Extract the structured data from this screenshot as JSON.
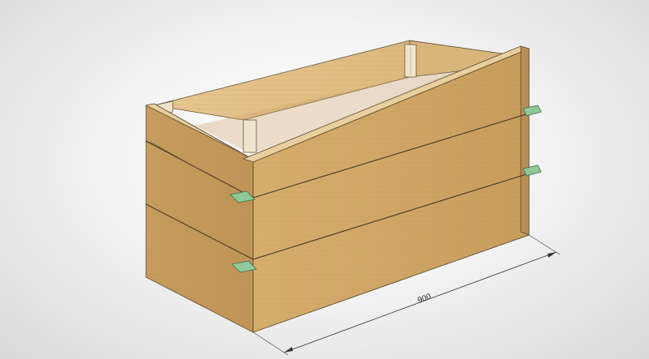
{
  "model": {
    "colors": {
      "wood_front": "#cfa766",
      "wood_side": "#c39a5c",
      "wood_inner": "#e3c18b",
      "edge": "#5a4a30",
      "bracket": "#8fc99a",
      "post": "#efe4cc",
      "background": "#e6e6e6"
    }
  },
  "dimension": {
    "label": "900"
  }
}
